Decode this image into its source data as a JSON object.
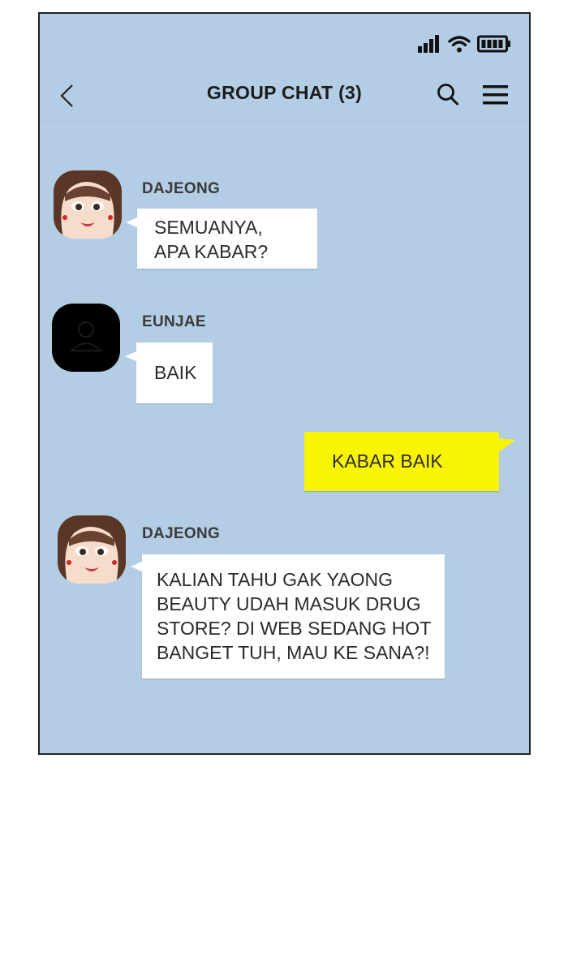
{
  "header": {
    "title": "GROUP CHAT (3)"
  },
  "icons": {
    "signal": "signal-icon",
    "wifi": "wifi-icon",
    "battery": "battery-icon",
    "back": "chevron-left-icon",
    "search": "search-icon",
    "menu": "hamburger-menu-icon"
  },
  "colors": {
    "chat_background": "#b3cde4",
    "incoming_bubble": "#ffffff",
    "outgoing_bubble": "#f9f502"
  },
  "messages": [
    {
      "sender": "DAJEONG",
      "text": "SEMUANYA,\nAPA KABAR?",
      "direction": "incoming"
    },
    {
      "sender": "EUNJAE",
      "text": "BAIK",
      "direction": "incoming"
    },
    {
      "text": "KABAR BAIK",
      "direction": "outgoing"
    },
    {
      "sender": "DAJEONG",
      "text": "KALIAN TAHU GAK YAONG\nBEAUTY UDAH MASUK DRUG\nSTORE? DI WEB SEDANG HOT\nBANGET TUH, MAU KE SANA?!",
      "direction": "incoming"
    }
  ]
}
